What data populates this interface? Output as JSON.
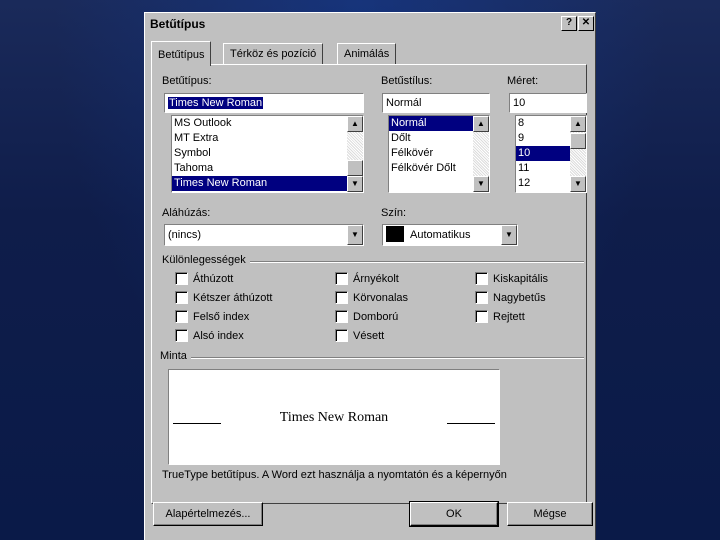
{
  "dialog": {
    "title": "Betűtípus",
    "help_glyph": "?",
    "close_glyph": "✕"
  },
  "tabs": [
    {
      "label": "Betűtípus"
    },
    {
      "label": "Térköz és pozíció"
    },
    {
      "label": "Animálás"
    }
  ],
  "font": {
    "label": "Betűtípus:",
    "value": "Times New Roman",
    "list": [
      "MS Outlook",
      "MT Extra",
      "Symbol",
      "Tahoma",
      "Times New Roman"
    ],
    "selected_index": 4
  },
  "style": {
    "label": "Betűstílus:",
    "value": "Normál",
    "list": [
      "Normál",
      "Dőlt",
      "Félkövér",
      "Félkövér Dőlt"
    ],
    "selected_index": 0
  },
  "size": {
    "label": "Méret:",
    "value": "10",
    "list": [
      "8",
      "9",
      "10",
      "11",
      "12"
    ],
    "selected_index": 2
  },
  "underline": {
    "label": "Aláhúzás:",
    "value": "(nincs)"
  },
  "color": {
    "label": "Szín:",
    "value": "Automatikus",
    "swatch": "#000000"
  },
  "effects": {
    "label": "Különlegességek",
    "col1": [
      "Áthúzott",
      "Kétszer áthúzott",
      "Felső index",
      "Alsó index"
    ],
    "col2": [
      "Árnyékolt",
      "Körvonalas",
      "Domború",
      "Vésett"
    ],
    "col3": [
      "Kiskapitális",
      "Nagybetűs",
      "Rejtett"
    ]
  },
  "preview": {
    "label": "Minta",
    "text": "Times New Roman",
    "note": "TrueType betűtípus. A Word ezt használja a nyomtatón és a képernyőn"
  },
  "buttons": {
    "default_label": "Alapértelmezés...",
    "ok_label": "OK",
    "cancel_label": "Mégse"
  }
}
